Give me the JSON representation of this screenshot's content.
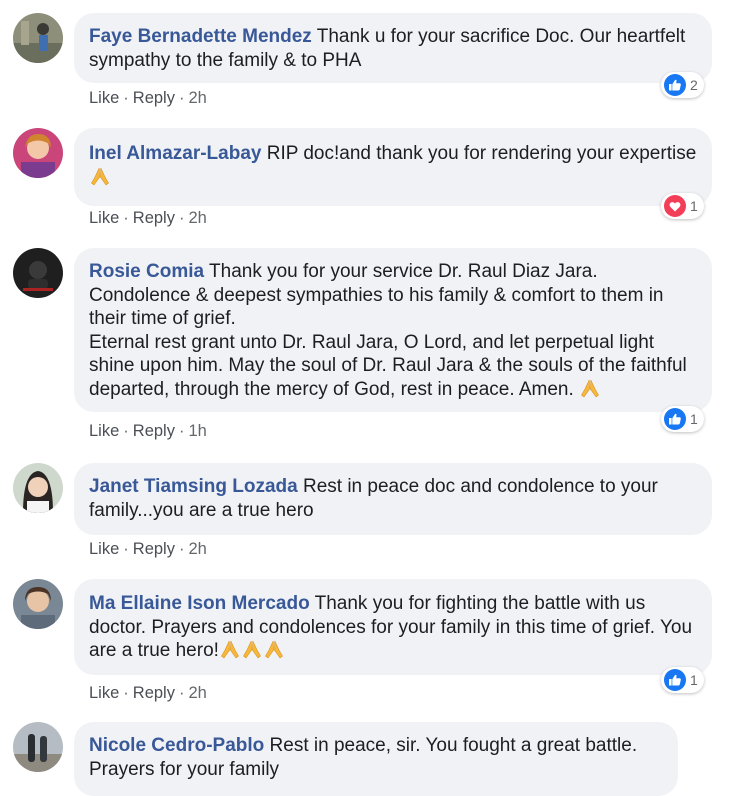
{
  "colors": {
    "author": "#385898",
    "bubble": "#f0f2f5",
    "like": "#1877f2",
    "love": "#f33e58",
    "pray": "#f6b73c"
  },
  "comments": [
    {
      "author": "Faye Bernadette Mendez",
      "text": "Thank u for your sacrifice Doc. Our heartfelt sympathy to the family & to PHA",
      "like": "Like",
      "reply": "Reply",
      "time": "2h",
      "reaction_icon": "like-icon",
      "reaction_count": "2"
    },
    {
      "author": "Inel Almazar-Labay",
      "text": "RIP doc!and thank you for rendering your expertise",
      "like": "Like",
      "reply": "Reply",
      "time": "2h",
      "reaction_icon": "love-icon",
      "reaction_count": "1",
      "trailing_emoji": "folded-hands-icon"
    },
    {
      "author": "Rosie Comia",
      "text": "Thank you for your service Dr. Raul Diaz Jara. Condolence & deepest sympathies to his family & comfort to them in their time of grief.",
      "text2": "Eternal rest grant unto Dr. Raul Jara, O Lord, and let perpetual light shine upon him. May the soul of Dr. Raul Jara & the souls of the faithful departed, through the mercy of God, rest in peace. Amen.",
      "like": "Like",
      "reply": "Reply",
      "time": "1h",
      "reaction_icon": "like-icon",
      "reaction_count": "1",
      "trailing_emoji": "folded-hands-icon"
    },
    {
      "author": "Janet Tiamsing Lozada",
      "text": "Rest in peace doc and condolence to your family...you are a true hero",
      "like": "Like",
      "reply": "Reply",
      "time": "2h"
    },
    {
      "author": "Ma Ellaine Ison Mercado",
      "text": "Thank you for fighting the battle with us doctor. Prayers and condolences for your family in this time of grief. You are a true hero!",
      "like": "Like",
      "reply": "Reply",
      "time": "2h",
      "reaction_icon": "like-icon",
      "reaction_count": "1",
      "trailing_emoji": "folded-hands-icon x3"
    },
    {
      "author": "Nicole Cedro-Pablo",
      "text": "Rest in peace, sir. You fought a great battle. Prayers for your family"
    }
  ]
}
